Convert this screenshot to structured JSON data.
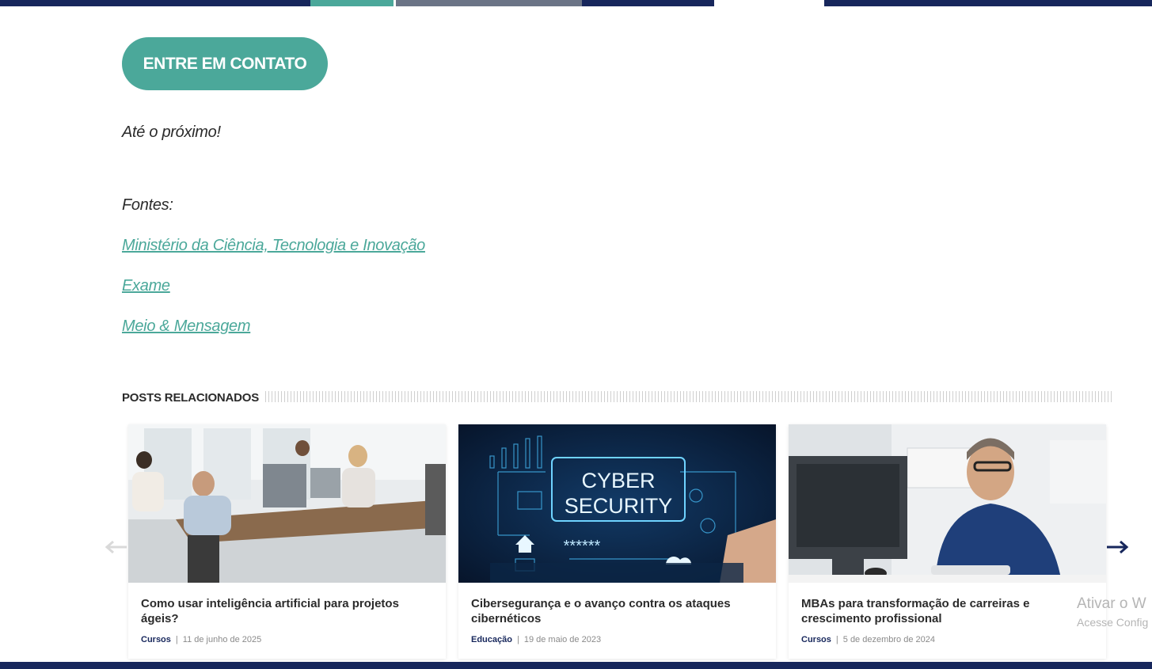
{
  "cta": {
    "label": "ENTRE EM CONTATO"
  },
  "closing": {
    "text": "Até o próximo!"
  },
  "sources": {
    "heading": "Fontes:",
    "links": [
      {
        "label": "Ministério da Ciência, Tecnologia e Inovação"
      },
      {
        "label": "Exame"
      },
      {
        "label": "Meio & Mensagem"
      }
    ]
  },
  "related": {
    "title": "POSTS RELACIONADOS",
    "prev_icon": "arrow-left-icon",
    "next_icon": "arrow-right-icon",
    "posts": [
      {
        "title": "Como usar inteligência artificial para projetos ágeis?",
        "category": "Cursos",
        "separator": "|",
        "date": "11 de junho de 2025"
      },
      {
        "title": "Cibersegurança e o avanço contra os ataques cibernéticos",
        "category": "Educação",
        "separator": "|",
        "date": "19 de maio de 2023",
        "image_text_1": "CYBER",
        "image_text_2": "SECURITY",
        "image_text_3": "******"
      },
      {
        "title": "MBAs para transformação de carreiras e crescimento profissional",
        "category": "Cursos",
        "separator": "|",
        "date": "5 de dezembro de 2024"
      }
    ]
  },
  "watermark": {
    "line1": "Ativar o W",
    "line2": "Acesse Config"
  },
  "colors": {
    "accent": "#4ba89a",
    "navy": "#17275c",
    "text": "#2b2b2b"
  }
}
